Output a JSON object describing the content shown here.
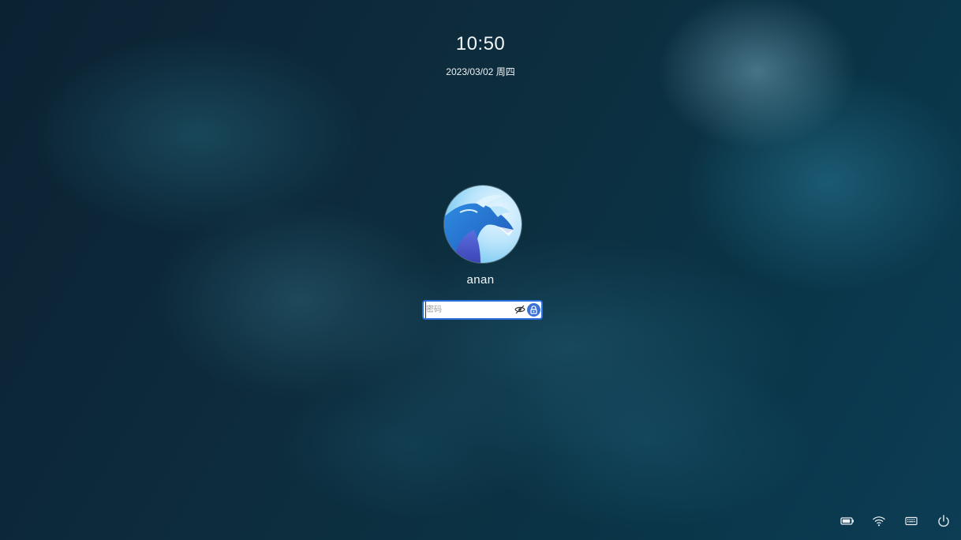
{
  "lockscreen": {
    "time": "10:50",
    "date": "2023/03/02 周四",
    "user": {
      "name": "anan",
      "avatar_icon": "dragon-avatar-icon"
    },
    "password": {
      "value": "",
      "placeholder": "密码",
      "toggle_icon": "eye-hidden-icon",
      "submit_icon": "unlock-icon"
    }
  },
  "tray": {
    "items": [
      {
        "name": "battery-icon"
      },
      {
        "name": "wifi-icon"
      },
      {
        "name": "keyboard-icon"
      },
      {
        "name": "power-icon"
      }
    ]
  },
  "colors": {
    "accent": "#3b72d8",
    "focus_border": "#2a6ee0",
    "text": "#f2f6f8"
  }
}
